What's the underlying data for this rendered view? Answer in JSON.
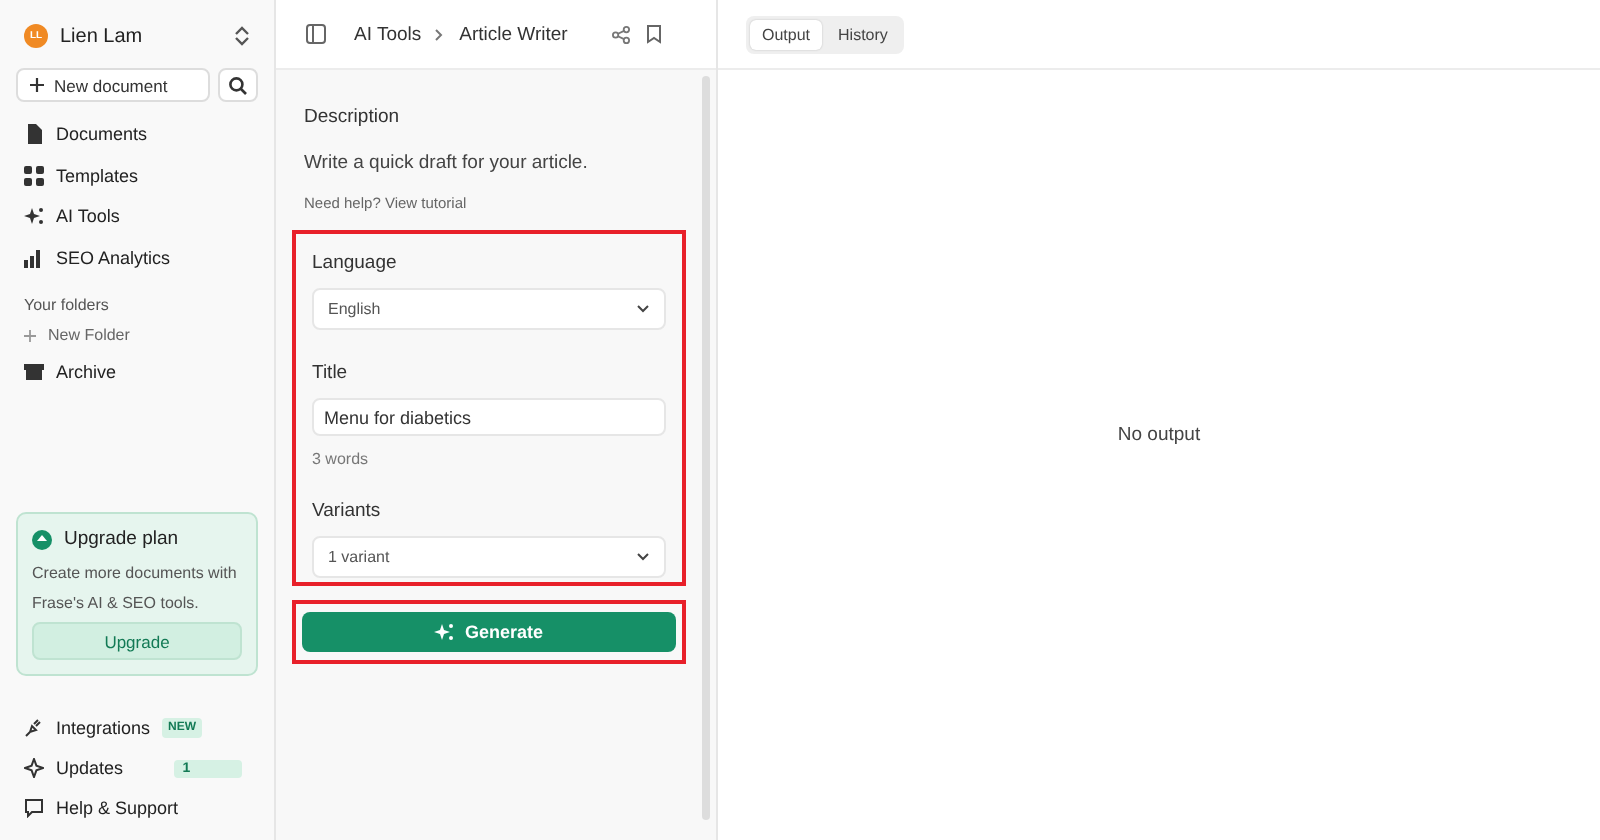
{
  "account": {
    "initials": "LL",
    "name": "Lien Lam"
  },
  "new_document": "New document",
  "nav": [
    {
      "label": "Documents",
      "kind": "doc"
    },
    {
      "label": "Templates",
      "kind": "grid"
    },
    {
      "label": "AI Tools",
      "kind": "sparkle"
    },
    {
      "label": "SEO Analytics",
      "kind": "bars"
    }
  ],
  "folders": {
    "heading": "Your folders",
    "new_folder": "New Folder",
    "items": [
      {
        "label": "Archive"
      }
    ]
  },
  "upgrade": {
    "title": "Upgrade plan",
    "text": "Create more documents with Frase's AI & SEO tools.",
    "button": "Upgrade"
  },
  "footer_nav": [
    {
      "label": "Integrations",
      "kind": "plug",
      "badge": "NEW"
    },
    {
      "label": "Updates",
      "kind": "star",
      "badge": "1"
    },
    {
      "label": "Help & Support",
      "kind": "chat"
    }
  ],
  "breadcrumb": [
    "AI Tools",
    "Article Writer"
  ],
  "form": {
    "description_heading": "Description",
    "description": "Write a quick draft for your article.",
    "help": "Need help? View tutorial",
    "language": {
      "label": "Language",
      "value": "English"
    },
    "title": {
      "label": "Title",
      "value": "Menu for diabetics",
      "hint": "3 words"
    },
    "variants": {
      "label": "Variants",
      "value": "1 variant"
    },
    "generate": "Generate"
  },
  "tabs": [
    {
      "label": "Output",
      "selected": true
    },
    {
      "label": "History",
      "selected": false
    }
  ],
  "empty": "No output"
}
